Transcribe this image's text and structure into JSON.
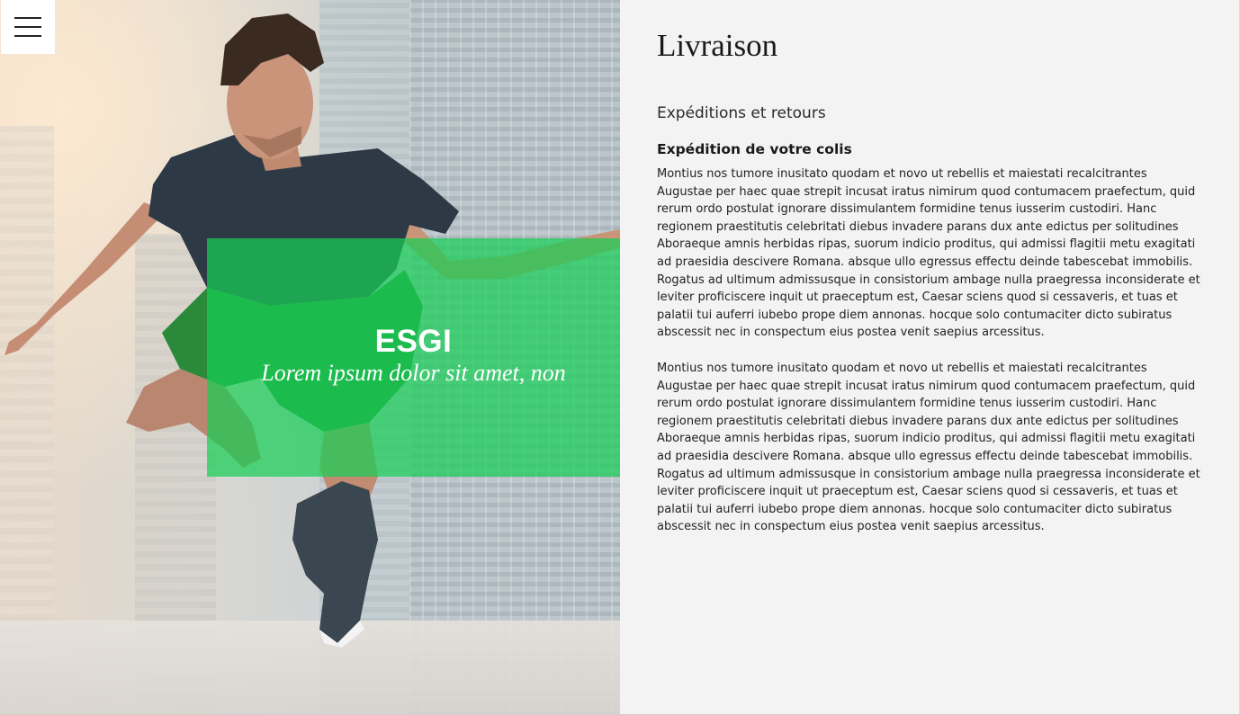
{
  "hero": {
    "title": "ESGI",
    "subtitle": "Lorem ipsum dolor sit amet, non"
  },
  "icons": {
    "menu": "hamburger-menu-icon"
  },
  "colors": {
    "overlay": "#18ce56",
    "content_bg": "#f3f3f3"
  },
  "content": {
    "title": "Livraison",
    "section_title": "Expéditions et retours",
    "subsection_title": "Expédition de votre colis",
    "paragraphs": [
      "Montius nos tumore inusitato quodam et novo ut rebellis et maiestati recalcitrantes Augustae per haec quae strepit incusat iratus nimirum quod contumacem praefectum, quid rerum ordo postulat ignorare dissimulantem formidine tenus iusserim custodiri. Hanc regionem praestitutis celebritati diebus invadere parans dux ante edictus per solitudines Aboraeque amnis herbidas ripas, suorum indicio proditus, qui admissi flagitii metu exagitati ad praesidia descivere Romana. absque ullo egressus effectu deinde tabescebat immobilis. Rogatus ad ultimum admissusque in consistorium ambage nulla praegressa inconsiderate et leviter proficiscere inquit ut praeceptum est, Caesar sciens quod si cessaveris, et tuas et palatii tui auferri iubebo prope diem annonas. hocque solo contumaciter dicto subiratus abscessit nec in conspectum eius postea venit saepius arcessitus.",
      "Montius nos tumore inusitato quodam et novo ut rebellis et maiestati recalcitrantes Augustae per haec quae strepit incusat iratus nimirum quod contumacem praefectum, quid rerum ordo postulat ignorare dissimulantem formidine tenus iusserim custodiri. Hanc regionem praestitutis celebritati diebus invadere parans dux ante edictus per solitudines Aboraeque amnis herbidas ripas, suorum indicio proditus, qui admissi flagitii metu exagitati ad praesidia descivere Romana. absque ullo egressus effectu deinde tabescebat immobilis. Rogatus ad ultimum admissusque in consistorium ambage nulla praegressa inconsiderate et leviter proficiscere inquit ut praeceptum est, Caesar sciens quod si cessaveris, et tuas et palatii tui auferri iubebo prope diem annonas. hocque solo contumaciter dicto subiratus abscessit nec in conspectum eius postea venit saepius arcessitus."
    ]
  }
}
